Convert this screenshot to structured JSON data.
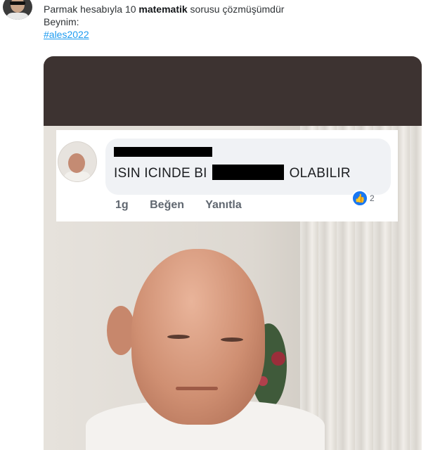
{
  "tweet": {
    "text_before_bold": "Parmak hesabıyla 10 ",
    "bold_word": "matematik",
    "text_after_bold": " sorusu çözmüşümdür",
    "line2": "Beynim:",
    "hashtag": "#ales2022"
  },
  "comment": {
    "text_before_redaction": "ISIN ICINDE BI",
    "text_after_redaction": "OLABILIR",
    "time": "1g",
    "like_label": "Beğen",
    "reply_label": "Yanıtla",
    "reaction_count": "2"
  },
  "colors": {
    "hashtag": "#1d9bf0",
    "like_reaction": "#1877f2",
    "top_bar": "#3d3331"
  },
  "icons": {
    "like_reaction": "thumbs-up-icon"
  }
}
